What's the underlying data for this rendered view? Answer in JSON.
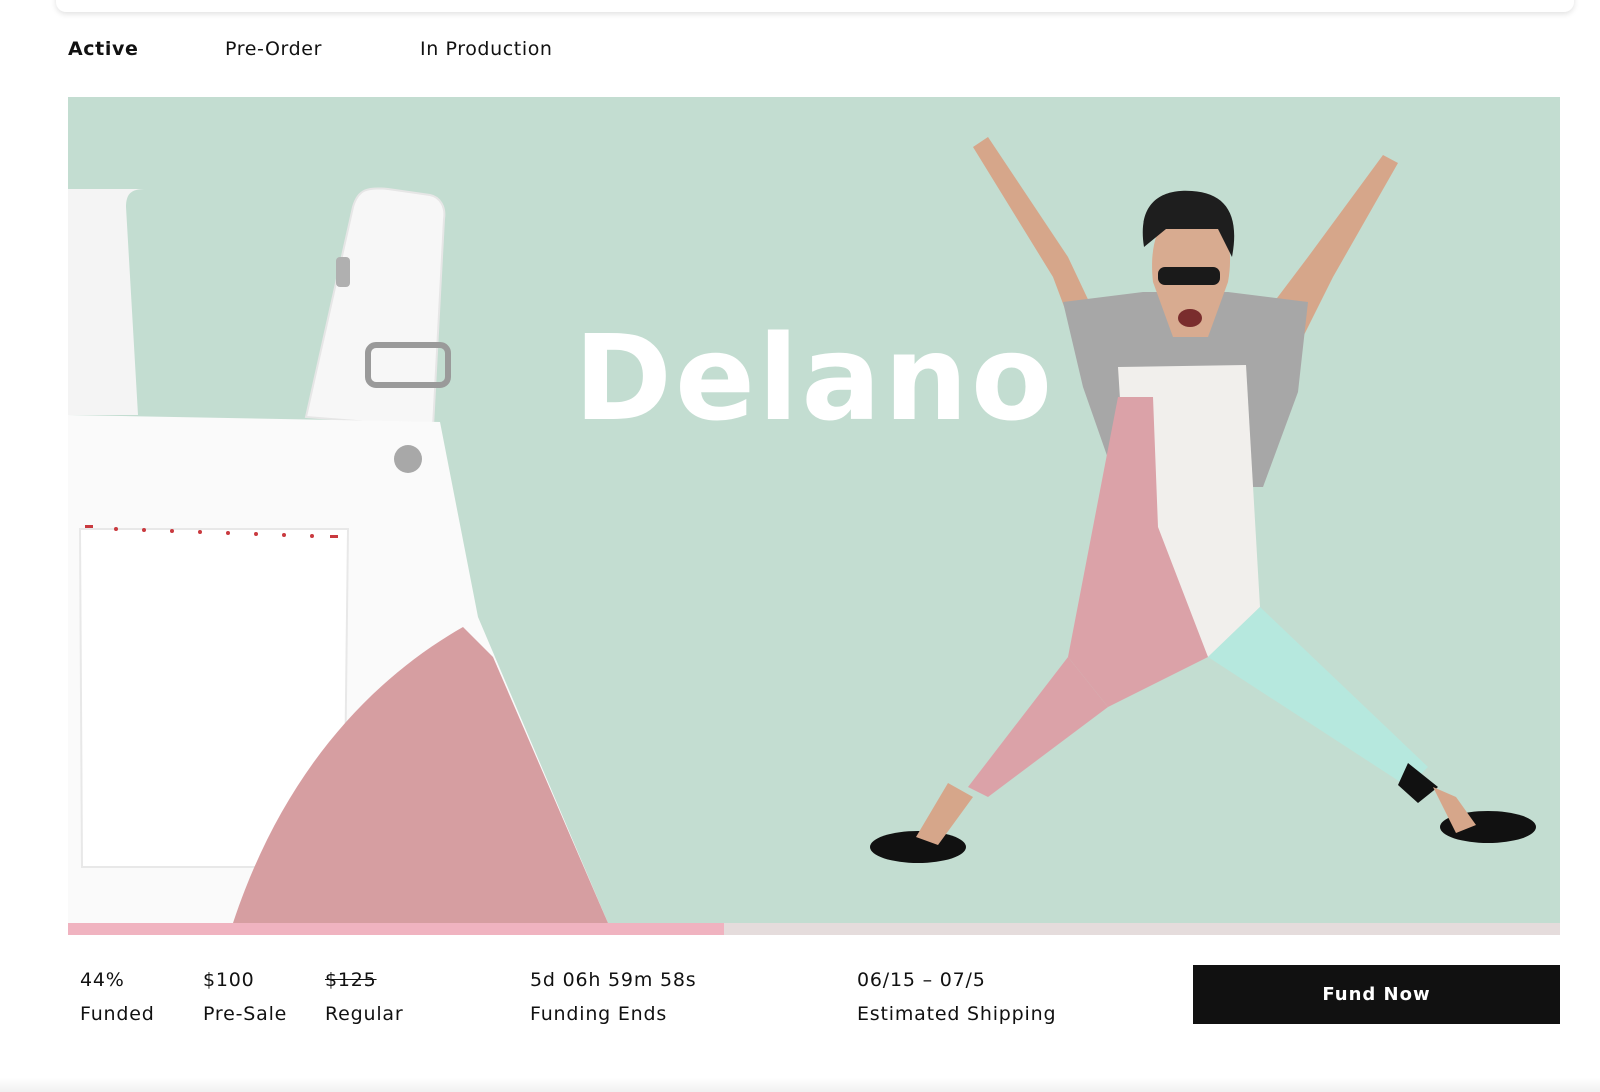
{
  "tabs": [
    {
      "label": "Active",
      "active": true
    },
    {
      "label": "Pre-Order",
      "active": false
    },
    {
      "label": "In Production",
      "active": false
    }
  ],
  "hero": {
    "title": "Delano",
    "background_color": "#c3ddd1"
  },
  "progress": {
    "percent_funded": 44,
    "fill_color": "#f0b3c0",
    "track_color": "#e5dcdc"
  },
  "stats": {
    "funded": {
      "value": "44%",
      "label": "Funded"
    },
    "presale": {
      "value": "$100",
      "label": "Pre-Sale"
    },
    "regular": {
      "value": "$125",
      "label": "Regular"
    },
    "funding_ends": {
      "value": "5d 06h 59m 58s",
      "label": "Funding Ends"
    },
    "shipping": {
      "value": "06/15 – 07/5",
      "label": "Estimated Shipping"
    }
  },
  "cta": {
    "label": "Fund Now",
    "color": "#111111"
  }
}
